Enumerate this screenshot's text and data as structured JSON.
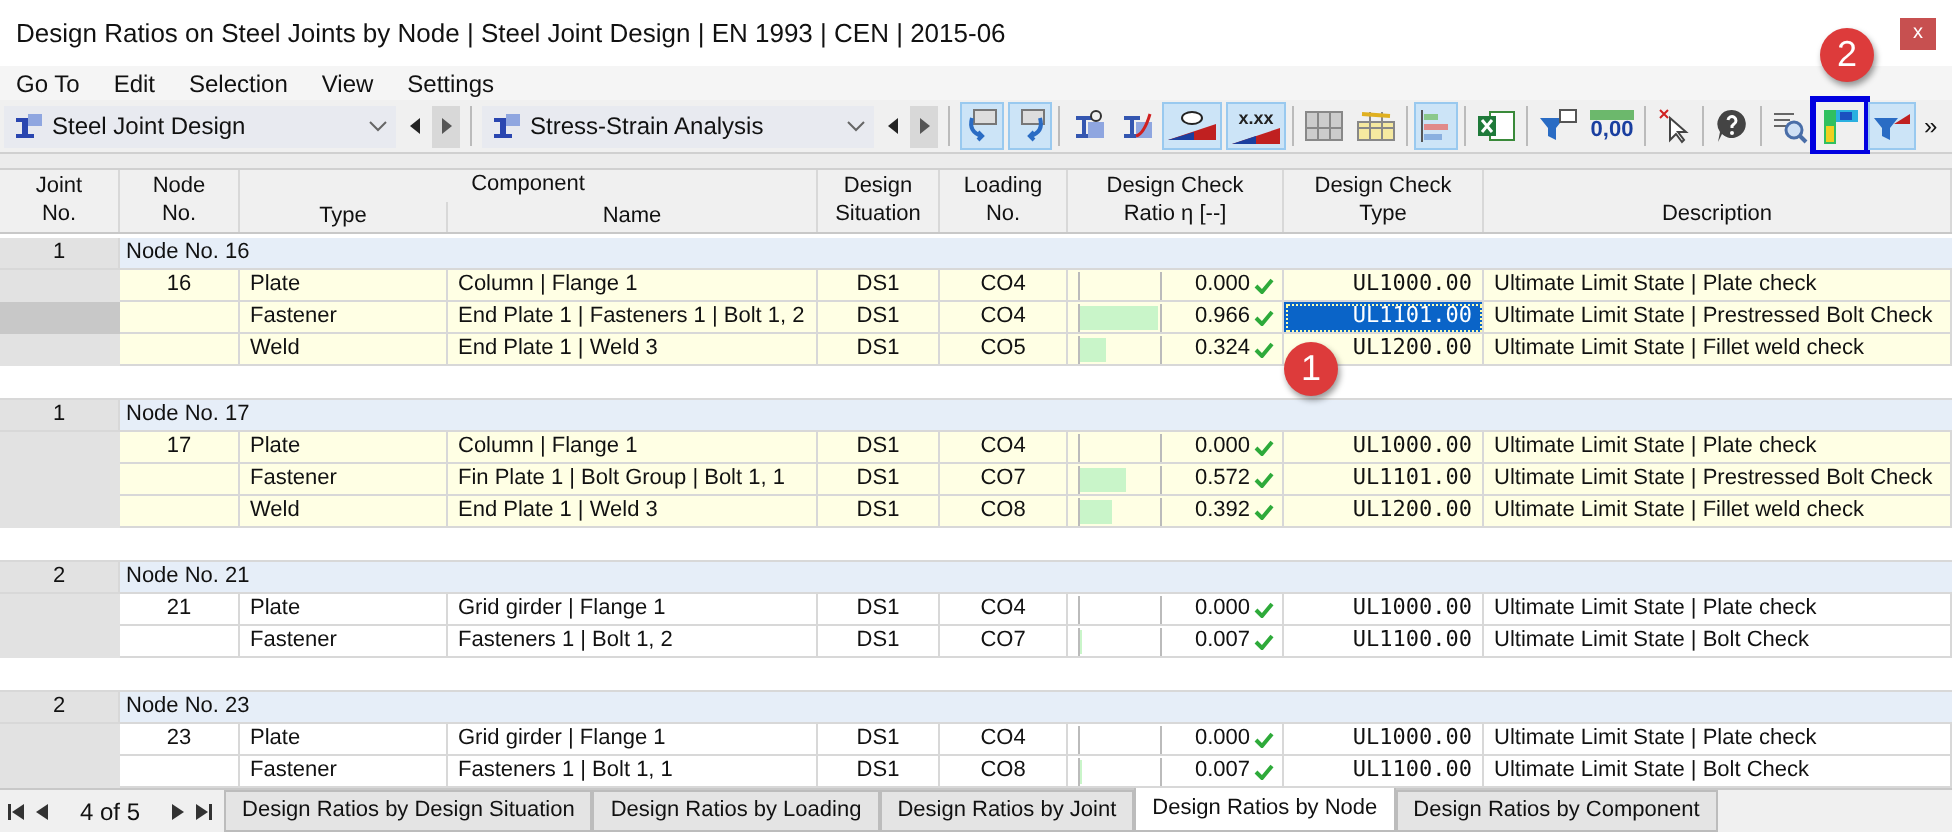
{
  "window": {
    "title": "Design Ratios on Steel Joints by Node | Steel Joint Design | EN 1993 | CEN | 2015-06",
    "close": "x"
  },
  "menu": [
    "Go To",
    "Edit",
    "Selection",
    "View",
    "Settings"
  ],
  "combos": [
    {
      "value": "Steel Joint Design"
    },
    {
      "value": "Stress-Strain Analysis"
    }
  ],
  "toolbar": [
    {
      "kind": "undo",
      "active": true
    },
    {
      "kind": "redo",
      "active": true
    },
    {
      "kind": "sep"
    },
    {
      "kind": "beam-glasses",
      "active": false
    },
    {
      "kind": "beam-curve",
      "active": false
    },
    {
      "kind": "beam-eye",
      "active": true
    },
    {
      "kind": "beam-text",
      "active": true,
      "label": "x.xx"
    },
    {
      "kind": "sep"
    },
    {
      "kind": "table",
      "active": false
    },
    {
      "kind": "table-link",
      "active": false
    },
    {
      "kind": "sep"
    },
    {
      "kind": "bars",
      "active": true
    },
    {
      "kind": "sep"
    },
    {
      "kind": "excel",
      "active": false
    },
    {
      "kind": "sep"
    },
    {
      "kind": "filter-screen",
      "active": false
    },
    {
      "kind": "ruler",
      "active": false,
      "label": "0,00"
    },
    {
      "kind": "sep"
    },
    {
      "kind": "cursor-x",
      "active": false
    },
    {
      "kind": "sep"
    },
    {
      "kind": "help",
      "active": false
    },
    {
      "kind": "sep"
    },
    {
      "kind": "magnify",
      "active": false
    },
    {
      "kind": "colormap",
      "active": false,
      "outlined": true
    },
    {
      "kind": "filter-beam",
      "active": true
    }
  ],
  "overflow": "»",
  "table": {
    "columns": {
      "joint": [
        "Joint",
        "No."
      ],
      "node": [
        "Node",
        "No."
      ],
      "component": "Component",
      "type": "Type",
      "name": "Name",
      "situation": [
        "Design",
        "Situation"
      ],
      "loading": [
        "Loading",
        "No."
      ],
      "ratio": [
        "Design Check",
        "Ratio η [--]"
      ],
      "check_type": [
        "Design Check",
        "Type"
      ],
      "description": "Description"
    },
    "groups": [
      {
        "joint": "1",
        "header": "Node No. 16",
        "highlighted": true,
        "rows": [
          {
            "node": "16",
            "type": "Plate",
            "name": "Column | Flange 1",
            "situation": "DS1",
            "loading": "CO4",
            "level": 0,
            "ratio": "0.000",
            "check_type": "UL1000.00",
            "description": "Ultimate Limit State | Plate check",
            "selected": false
          },
          {
            "type": "Fastener",
            "name": "End Plate 1 | Fasteners 1 | Bolt 1, 2",
            "situation": "DS1",
            "loading": "CO4",
            "level": 0.966,
            "ratio": "0.966",
            "check_type": "UL1101.00",
            "description": "Ultimate Limit State | Prestressed Bolt Check",
            "selected": true
          },
          {
            "type": "Weld",
            "name": "End Plate 1 | Weld 3",
            "situation": "DS1",
            "loading": "CO5",
            "level": 0.324,
            "ratio": "0.324",
            "check_type": "UL1200.00",
            "description": "Ultimate Limit State | Fillet weld check",
            "selected": false
          }
        ]
      },
      {
        "joint": "1",
        "header": "Node No. 17",
        "highlighted": true,
        "rows": [
          {
            "node": "17",
            "type": "Plate",
            "name": "Column | Flange 1",
            "situation": "DS1",
            "loading": "CO4",
            "level": 0,
            "ratio": "0.000",
            "check_type": "UL1000.00",
            "description": "Ultimate Limit State | Plate check",
            "selected": false
          },
          {
            "type": "Fastener",
            "name": "Fin Plate 1 | Bolt Group | Bolt 1, 1",
            "situation": "DS1",
            "loading": "CO7",
            "level": 0.572,
            "ratio": "0.572",
            "check_type": "UL1101.00",
            "description": "Ultimate Limit State | Prestressed Bolt Check",
            "selected": false
          },
          {
            "type": "Weld",
            "name": "End Plate 1 | Weld 3",
            "situation": "DS1",
            "loading": "CO8",
            "level": 0.392,
            "ratio": "0.392",
            "check_type": "UL1200.00",
            "description": "Ultimate Limit State | Fillet weld check",
            "selected": false
          }
        ]
      },
      {
        "joint": "2",
        "header": "Node No. 21",
        "highlighted": false,
        "rows": [
          {
            "node": "21",
            "type": "Plate",
            "name": "Grid girder | Flange 1",
            "situation": "DS1",
            "loading": "CO4",
            "level": 0,
            "ratio": "0.000",
            "check_type": "UL1000.00",
            "description": "Ultimate Limit State | Plate check",
            "selected": false
          },
          {
            "type": "Fastener",
            "name": "Fasteners 1 | Bolt 1, 2",
            "situation": "DS1",
            "loading": "CO7",
            "level": 0.007,
            "ratio": "0.007",
            "check_type": "UL1100.00",
            "description": "Ultimate Limit State | Bolt Check",
            "selected": false
          }
        ]
      },
      {
        "joint": "2",
        "header": "Node No. 23",
        "highlighted": false,
        "rows": [
          {
            "node": "23",
            "type": "Plate",
            "name": "Grid girder | Flange 1",
            "situation": "DS1",
            "loading": "CO4",
            "level": 0,
            "ratio": "0.000",
            "check_type": "UL1000.00",
            "description": "Ultimate Limit State | Plate check",
            "selected": false
          },
          {
            "type": "Fastener",
            "name": "Fasteners 1 | Bolt 1, 1",
            "situation": "DS1",
            "loading": "CO8",
            "level": 0.007,
            "ratio": "0.007",
            "check_type": "UL1100.00",
            "description": "Ultimate Limit State | Bolt Check",
            "selected": false
          }
        ]
      }
    ]
  },
  "callouts": [
    "1",
    "2"
  ],
  "pager": "4 of 5",
  "tabs": [
    {
      "label": "Design Ratios by Design Situation",
      "selected": false
    },
    {
      "label": "Design Ratios by Loading",
      "selected": false
    },
    {
      "label": "Design Ratios by Joint",
      "selected": false
    },
    {
      "label": "Design Ratios by Node",
      "selected": true
    },
    {
      "label": "Design Ratios by Component",
      "selected": false
    }
  ]
}
